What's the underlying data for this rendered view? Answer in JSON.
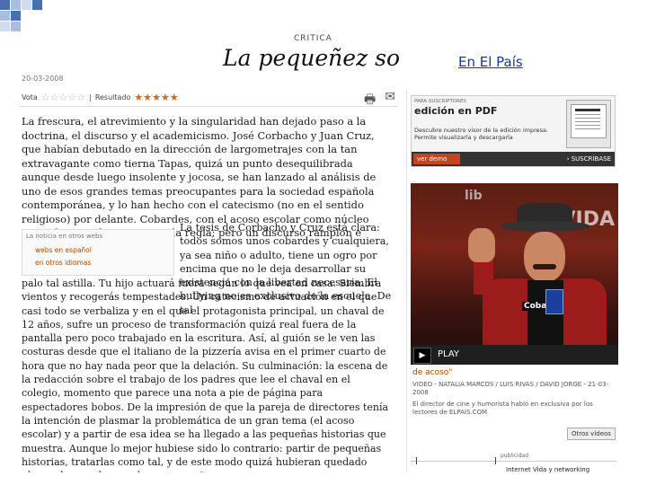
{
  "slide": {
    "link_text": "En El País",
    "accent": "#1a3a9a"
  },
  "article": {
    "kicker": "CRITICA",
    "headline": "La pequeñez social",
    "date": "20-03-2008",
    "vote_label": "Vota",
    "result_label": "Resultado",
    "vote_stars": "☆☆☆☆☆",
    "result_stars": "★★★★★",
    "result_rating_fraction": 0.8,
    "lead": "La frescura, el atrevimiento y la singularidad han dejado paso a la doctrina, el discurso y el academicismo. José Corbacho y Juan Cruz, que habían debutado en la dirección de largometrajes con la tan extravagante como tierna Tapas, quizá un punto desequilibrada aunque desde luego insolente y jocosa, se han lanzado al análisis de uno de esos grandes temas preocupantes para la sociedad española contemporánea, y lo han hecho con el catecismo (no en el sentido religioso) por delante. Cobardes, con el acoso escolar como núcleo central, es un discurso en toda regla; pero un discurso ramplón e intrascendente.",
    "body_right": "La tesis de Corbacho y Cruz está clara: todos somos unos cobardes y cualquiera, ya sea niño o adulto, tiene un ogro por encima que no le deja desarrollar su existencia con la libertad necesaria. El bullying no es exclusivo de la escuela. De tal",
    "body_full": "palo tal astilla. Tu hijo actuará fuera según lo que vea en casa. Siembra vientos y recogerás tempestades. Un catecismo de actuación en el que casi todo se verbaliza y en el que el protagonista principal, un chaval de 12 años, sufre un proceso de transformación quizá real fuera de la pantalla pero poco trabajado en la escritura. Así, al guión se le ven las costuras desde que el italiano de la pizzería avisa en el primer cuarto de hora que no hay nada peor que la delación. Su culminación: la escena de la redacción sobre el trabajo de los padres que lee el chaval en el colegio, momento que parece una nota a pie de página para espectadores bobos. De la impresión de que la pareja de directores tenía la intención de plasmar la problemática de un gran tema (el acoso escolar) y a partir de esa idea se ha llegado a las pequeñas historias que muestra. Aunque lo mejor hubiese sido lo contrario: partir de pequeñas historias, tratarlas como tal, y de este modo quizá hubieran quedado plasmadas con la grandeza necesaria.",
    "related": {
      "title": "La noticia en otros webs",
      "links": [
        "webs en español",
        "en otros idiomas"
      ]
    }
  },
  "sidebar": {
    "pdf": {
      "small": "PARA SUSCRIPTORES",
      "big": "edición en PDF",
      "desc": "Descubre nuestro visor de la edición impresa. Permite visualizarla y descargarla",
      "demo_label": "ver demo",
      "subscribe_label": "› SUSCRÍBASE"
    },
    "video": {
      "bg_text": "VIDA",
      "logo": "lib",
      "shirt_text": "Cobar",
      "play_label": "PLAY",
      "title": "de acoso\"",
      "meta": "VIDEO - NATALIA MARCOS / LUIS RIVAS / DAVID JORGE - 21-03-2008",
      "desc": "El director de cine y humorista habló en exclusiva por los lectores de ELPAÍS.COM",
      "more_label": "Otros vídeos"
    },
    "ad": {
      "label": "publicidad",
      "text": "Internet Vida y networking"
    }
  }
}
